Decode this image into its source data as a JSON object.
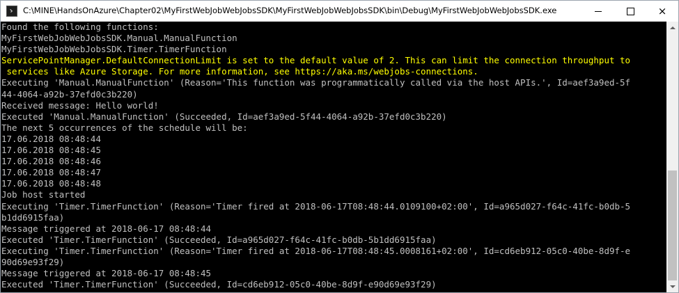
{
  "window": {
    "title": "C:\\MINE\\HandsOnAzure\\Chapter02\\MyFirstWebJobWebJobsSDK\\MyFirstWebJobWebJobsSDK\\bin\\Debug\\MyFirstWebJobWebJobsSDK.exe",
    "icon": "console-app-icon",
    "controls": {
      "minimize": "minimize-icon",
      "maximize": "maximize-icon",
      "close": "×"
    }
  },
  "colors": {
    "background": "#000000",
    "text": "#c0c0c0",
    "warning": "#ffff00"
  },
  "console": {
    "lines": [
      {
        "text": "Found the following functions:",
        "kind": "normal"
      },
      {
        "text": "MyFirstWebJobWebJobsSDK.Manual.ManualFunction",
        "kind": "normal"
      },
      {
        "text": "MyFirstWebJobWebJobsSDK.Timer.TimerFunction",
        "kind": "normal"
      },
      {
        "text": "ServicePointManager.DefaultConnectionLimit is set to the default value of 2. This can limit the connection throughput to",
        "kind": "warn"
      },
      {
        "text": " services like Azure Storage. For more information, see https://aka.ms/webjobs-connections.",
        "kind": "warn"
      },
      {
        "text": "Executing 'Manual.ManualFunction' (Reason='This function was programmatically called via the host APIs.', Id=aef3a9ed-5f",
        "kind": "normal"
      },
      {
        "text": "44-4064-a92b-37efd0c3b220)",
        "kind": "normal"
      },
      {
        "text": "Received message: Hello world!",
        "kind": "normal"
      },
      {
        "text": "Executed 'Manual.ManualFunction' (Succeeded, Id=aef3a9ed-5f44-4064-a92b-37efd0c3b220)",
        "kind": "normal"
      },
      {
        "text": "The next 5 occurrences of the schedule will be:",
        "kind": "normal"
      },
      {
        "text": "17.06.2018 08:48:44",
        "kind": "normal"
      },
      {
        "text": "17.06.2018 08:48:45",
        "kind": "normal"
      },
      {
        "text": "17.06.2018 08:48:46",
        "kind": "normal"
      },
      {
        "text": "17.06.2018 08:48:47",
        "kind": "normal"
      },
      {
        "text": "17.06.2018 08:48:48",
        "kind": "normal"
      },
      {
        "text": "Job host started",
        "kind": "normal"
      },
      {
        "text": "Executing 'Timer.TimerFunction' (Reason='Timer fired at 2018-06-17T08:48:44.0109100+02:00', Id=a965d027-f64c-41fc-b0db-5",
        "kind": "normal"
      },
      {
        "text": "b1dd6915faa)",
        "kind": "normal"
      },
      {
        "text": "Message triggered at 2018-06-17 08:48:44",
        "kind": "normal"
      },
      {
        "text": "Executed 'Timer.TimerFunction' (Succeeded, Id=a965d027-f64c-41fc-b0db-5b1dd6915faa)",
        "kind": "normal"
      },
      {
        "text": "Executing 'Timer.TimerFunction' (Reason='Timer fired at 2018-06-17T08:48:45.0008161+02:00', Id=cd6eb912-05c0-40be-8d9f-e",
        "kind": "normal"
      },
      {
        "text": "90d69e93f29)",
        "kind": "normal"
      },
      {
        "text": "Message triggered at 2018-06-17 08:48:45",
        "kind": "normal"
      },
      {
        "text": "Executed 'Timer.TimerFunction' (Succeeded, Id=cd6eb912-05c0-40be-8d9f-e90d69e93f29)",
        "kind": "normal"
      }
    ]
  },
  "scrollbar": {
    "up_icon": "scroll-up-arrow-icon",
    "down_icon": "scroll-down-arrow-icon"
  }
}
